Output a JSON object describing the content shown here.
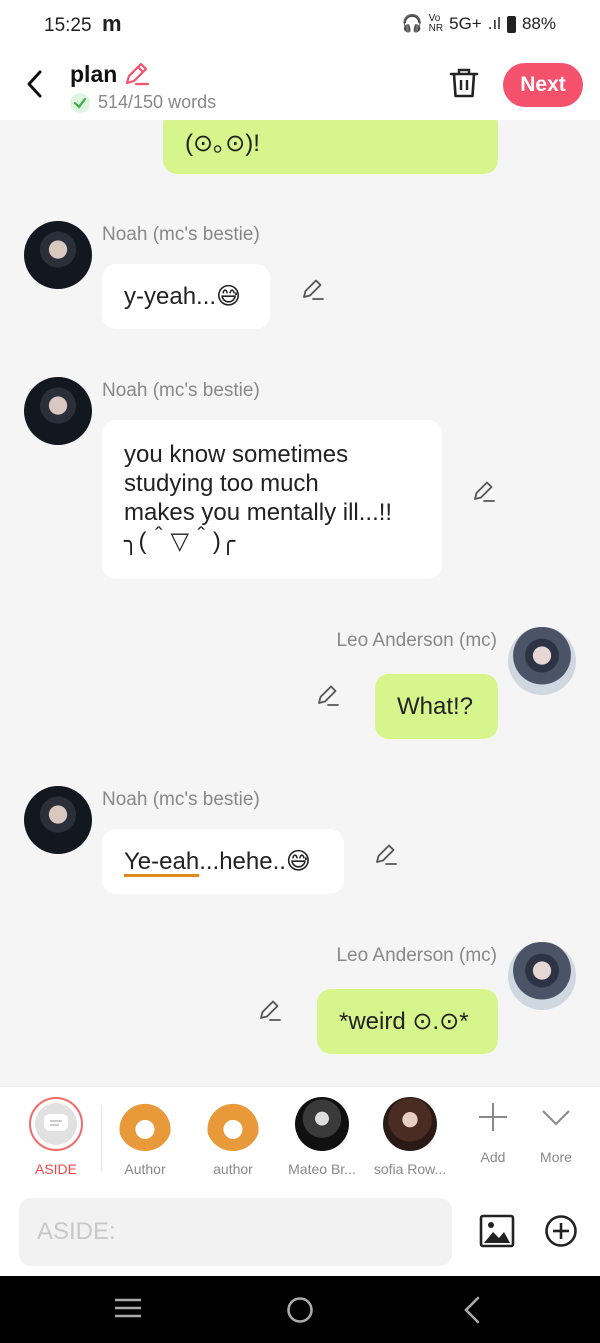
{
  "status": {
    "time": "15:25",
    "carrier_icon": "m",
    "network": "5G+",
    "battery": "88%"
  },
  "header": {
    "title": "plan",
    "word_count": "514/150 words",
    "next_label": "Next"
  },
  "messages": [
    {
      "text": "(⊙｡⊙)!"
    },
    {
      "sender": "Noah (mc's bestie)",
      "text": "y-yeah...😅"
    },
    {
      "sender": "Noah (mc's bestie)",
      "text": "you know sometimes\nstudying too much\nmakes you mentally ill...!!\n╮(＾▽＾)╭"
    },
    {
      "sender": "Leo Anderson (mc)",
      "text": "What!?"
    },
    {
      "sender": "Noah (mc's bestie)",
      "text_underlined": "Ye-eah",
      "text_rest": "...hehe..😅"
    },
    {
      "sender": "Leo Anderson (mc)",
      "text": "*weird ⊙.⊙*"
    }
  ],
  "characters": [
    {
      "label": "ASIDE"
    },
    {
      "label": "Author"
    },
    {
      "label": "author"
    },
    {
      "label": "Mateo Br..."
    },
    {
      "label": "sofia Row..."
    }
  ],
  "controls": {
    "add_label": "Add",
    "more_label": "More"
  },
  "input": {
    "placeholder": "ASIDE:"
  },
  "colors": {
    "accent": "#f4516c",
    "mc_bubble": "#d6f58d",
    "aside_active": "#f04848"
  }
}
